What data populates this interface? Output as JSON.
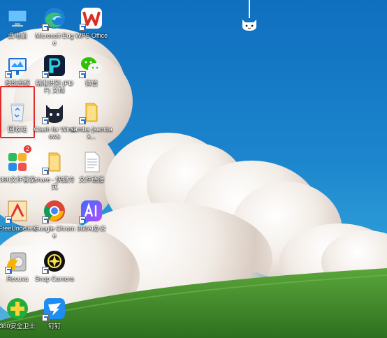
{
  "desktop": {
    "icons": [
      {
        "label": "此电脑",
        "icon": "computer-icon"
      },
      {
        "label": "Microsoft Edge",
        "icon": "edge-icon"
      },
      {
        "label": "WPS Office",
        "icon": "wps-icon"
      },
      {
        "label": "投影画板",
        "icon": "projector-board-icon"
      },
      {
        "label": "精准识别 (PDF) 文档",
        "icon": "pdf-reader-icon"
      },
      {
        "label": "微信",
        "icon": "wechat-icon"
      },
      {
        "label": "回收站",
        "icon": "recycle-bin-icon"
      },
      {
        "label": "Clash for Windows",
        "icon": "clash-cat-icon"
      },
      {
        "label": "samba (sambak...",
        "icon": "folder-icon"
      },
      {
        "label": "360文件管家",
        "icon": "file-manager-360-icon",
        "badge": "2"
      },
      {
        "label": "share - 快捷方式",
        "icon": "folder-shortcut-icon"
      },
      {
        "label": "文件链接",
        "icon": "document-icon"
      },
      {
        "label": "FreeUndelete",
        "icon": "free-undelete-icon"
      },
      {
        "label": "Google Chrome",
        "icon": "chrome-icon"
      },
      {
        "label": "360AI办公",
        "icon": "ai-office-icon"
      },
      {
        "label": "Recuva",
        "icon": "recuva-icon"
      },
      {
        "label": "Snap Camera",
        "icon": "snap-camera-icon"
      },
      {
        "label": "360安全卫士",
        "icon": "security-360-icon"
      },
      {
        "label": "钉钉",
        "icon": "dingtalk-icon"
      }
    ]
  },
  "colors": {
    "sky": "#1b84cc",
    "grass": "#3f8f2c",
    "selection": "#e02b2b",
    "wechat": "#2dc100",
    "wps": "#d93025"
  }
}
